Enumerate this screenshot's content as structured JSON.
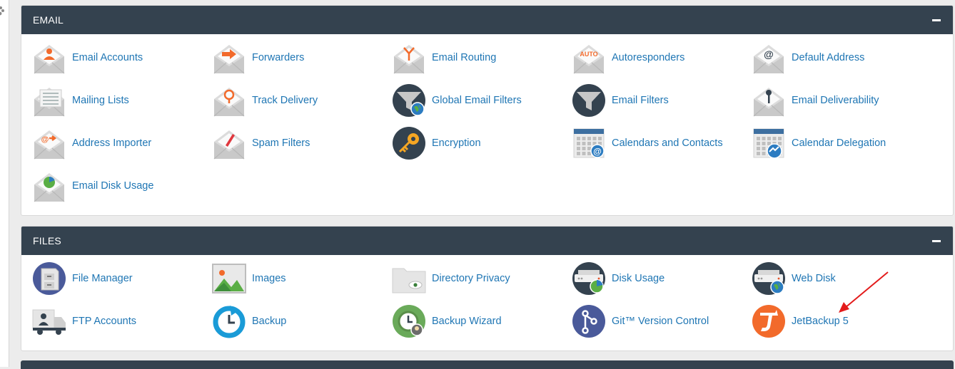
{
  "sections": {
    "email": {
      "title": "EMAIL",
      "items": [
        {
          "label": "Email Accounts",
          "icon": "envelope-user-icon"
        },
        {
          "label": "Forwarders",
          "icon": "envelope-forward-icon"
        },
        {
          "label": "Email Routing",
          "icon": "envelope-routing-icon"
        },
        {
          "label": "Autoresponders",
          "icon": "envelope-auto-icon"
        },
        {
          "label": "Default Address",
          "icon": "envelope-at-icon"
        },
        {
          "label": "Mailing Lists",
          "icon": "envelope-list-icon"
        },
        {
          "label": "Track Delivery",
          "icon": "envelope-pin-icon"
        },
        {
          "label": "Global Email Filters",
          "icon": "funnel-globe-icon"
        },
        {
          "label": "Email Filters",
          "icon": "funnel-icon"
        },
        {
          "label": "Email Deliverability",
          "icon": "envelope-key-icon"
        },
        {
          "label": "Address Importer",
          "icon": "envelope-import-icon"
        },
        {
          "label": "Spam Filters",
          "icon": "envelope-spam-icon"
        },
        {
          "label": "Encryption",
          "icon": "key-icon"
        },
        {
          "label": "Calendars and Contacts",
          "icon": "calendar-at-icon"
        },
        {
          "label": "Calendar Delegation",
          "icon": "calendar-handshake-icon"
        },
        {
          "label": "Email Disk Usage",
          "icon": "envelope-pie-icon"
        }
      ]
    },
    "files": {
      "title": "FILES",
      "items": [
        {
          "label": "File Manager",
          "icon": "file-cabinet-icon"
        },
        {
          "label": "Images",
          "icon": "image-icon"
        },
        {
          "label": "Directory Privacy",
          "icon": "folder-eye-icon"
        },
        {
          "label": "Disk Usage",
          "icon": "server-pie-icon"
        },
        {
          "label": "Web Disk",
          "icon": "server-globe-icon"
        },
        {
          "label": "FTP Accounts",
          "icon": "ftp-truck-icon"
        },
        {
          "label": "Backup",
          "icon": "backup-clock-icon"
        },
        {
          "label": "Backup Wizard",
          "icon": "backup-wizard-icon"
        },
        {
          "label": "Git™ Version Control",
          "icon": "git-branch-icon"
        },
        {
          "label": "JetBackup 5",
          "icon": "jetbackup-icon"
        }
      ]
    }
  },
  "colors": {
    "header": "#34424f",
    "link": "#1f76b4",
    "annotation_arrow": "#e31b1b"
  }
}
